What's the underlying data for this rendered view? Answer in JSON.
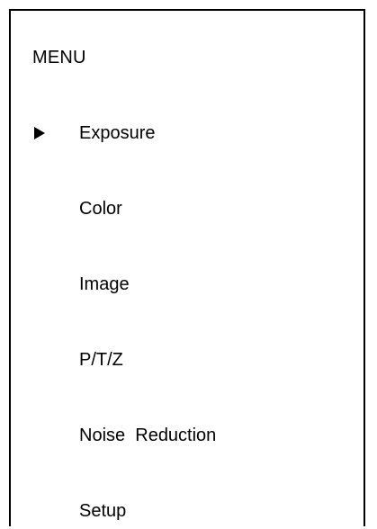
{
  "menu": {
    "title": "MENU",
    "selected_index": 0,
    "cursor_icon": "right-triangle-icon",
    "items": [
      {
        "label": "Exposure"
      },
      {
        "label": "Color"
      },
      {
        "label": "Image"
      },
      {
        "label": "P/T/Z"
      },
      {
        "label": "Noise  Reduction"
      },
      {
        "label": "Setup"
      }
    ]
  }
}
